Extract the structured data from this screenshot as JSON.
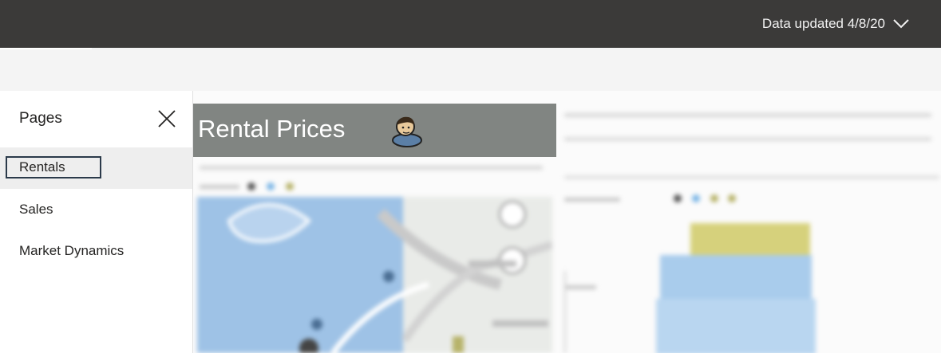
{
  "topbar": {
    "updated_label": "Data updated 4/8/20",
    "background": "#3b3a39"
  },
  "pages_panel": {
    "title": "Pages",
    "close_icon": "close-icon",
    "items": [
      {
        "label": "Rentals",
        "selected": true
      },
      {
        "label": "Sales",
        "selected": false
      },
      {
        "label": "Market Dynamics",
        "selected": false
      }
    ]
  },
  "report": {
    "header_title": "Rental Prices",
    "header_background": "#818582",
    "avatar_icon": "person-avatar-icon"
  }
}
